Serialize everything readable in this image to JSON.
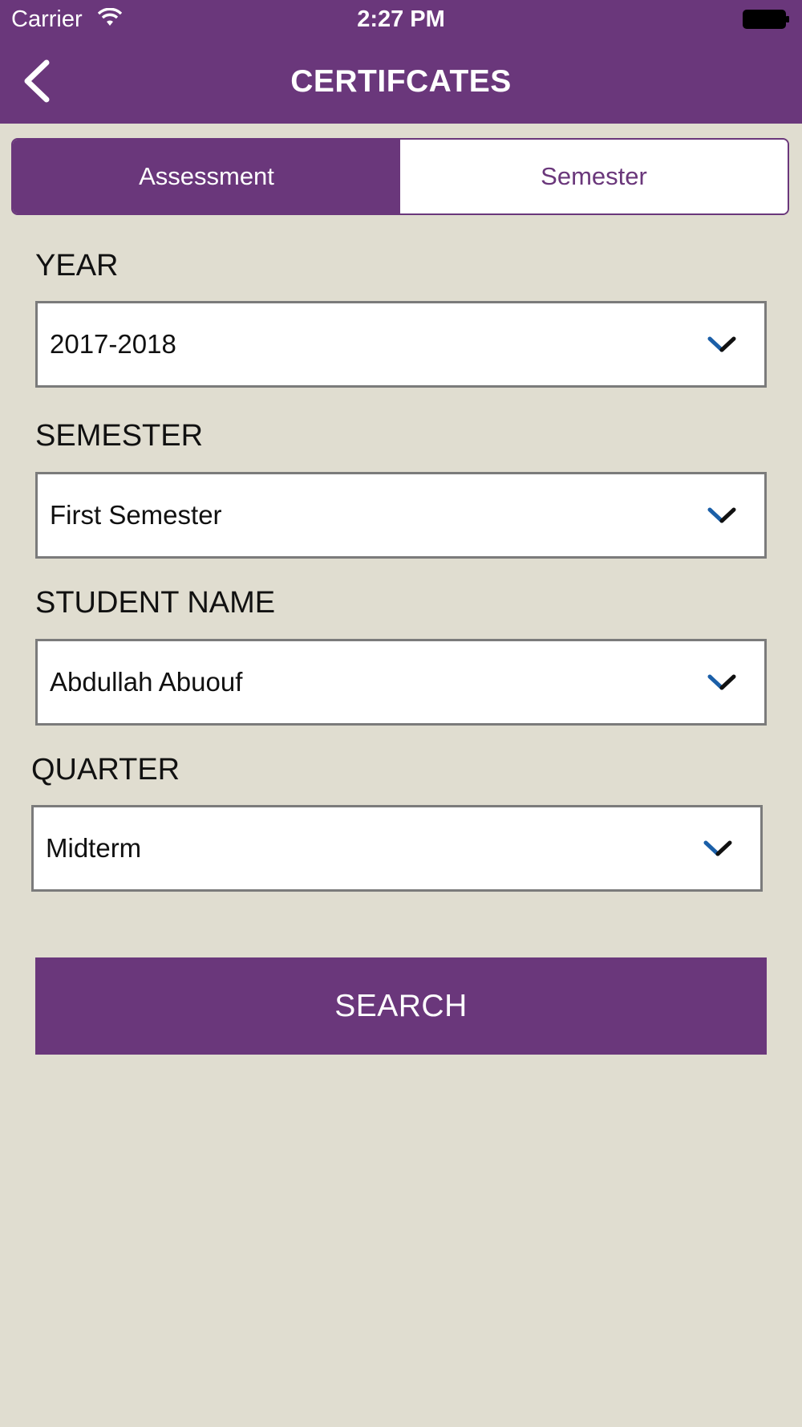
{
  "status_bar": {
    "carrier": "Carrier",
    "time": "2:27 PM"
  },
  "header": {
    "title": "CERTIFCATES",
    "back_icon": "chevron-left-icon"
  },
  "tabs": [
    {
      "label": "Assessment",
      "active": true
    },
    {
      "label": "Semester",
      "active": false
    }
  ],
  "form": {
    "year": {
      "label": "YEAR",
      "value": "2017-2018"
    },
    "semester": {
      "label": "SEMESTER",
      "value": "First Semester"
    },
    "student": {
      "label": "STUDENT NAME",
      "value": "Abdullah Abuouf"
    },
    "quarter": {
      "label": "QUARTER",
      "value": "Midterm"
    }
  },
  "search_button": {
    "label": "SEARCH"
  },
  "colors": {
    "primary": "#6a377b",
    "background": "#e0ddd0",
    "chevron_accent": "#1b5fa8"
  }
}
